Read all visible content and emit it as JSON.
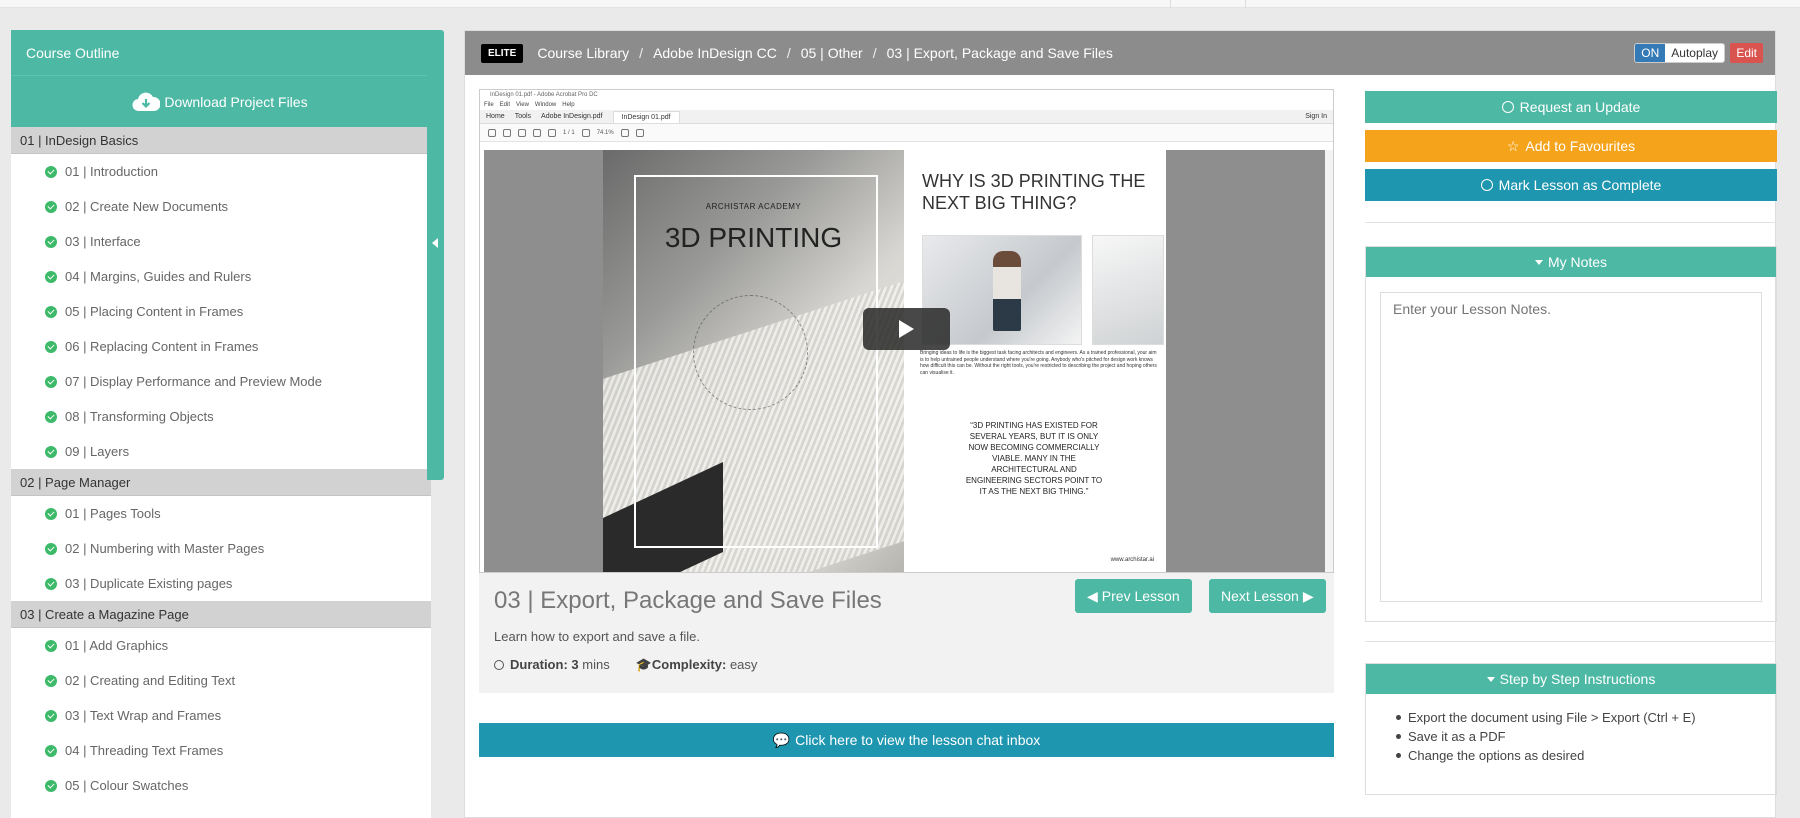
{
  "sidebar": {
    "header": "Course Outline",
    "download_label": "Download Project Files",
    "sections": [
      {
        "title": "01 | InDesign Basics",
        "lessons": [
          "01 | Introduction",
          "02 | Create New Documents",
          "03 | Interface",
          "04 | Margins, Guides and Rulers",
          "05 | Placing Content in Frames",
          "06 | Replacing Content in Frames",
          "07 | Display Performance and Preview Mode",
          "08 | Transforming Objects",
          "09 | Layers"
        ]
      },
      {
        "title": "02 | Page Manager",
        "lessons": [
          "01 | Pages Tools",
          "02 | Numbering with Master Pages",
          "03 | Duplicate Existing pages"
        ]
      },
      {
        "title": "03 | Create a Magazine Page",
        "lessons": [
          "01 | Add Graphics",
          "02 | Creating and Editing Text",
          "03 | Text Wrap and Frames",
          "04 | Threading Text Frames",
          "05 | Colour Swatches"
        ]
      }
    ]
  },
  "breadcrumb": {
    "badge": "ELITE",
    "items": [
      "Course Library",
      "Adobe InDesign CC",
      "05 | Other",
      "03 | Export, Package and Save Files"
    ]
  },
  "autoplay": {
    "state": "ON",
    "label": "Autoplay"
  },
  "edit_label": "Edit",
  "video": {
    "window_title": "InDesign 01.pdf - Adobe Acrobat Pro DC",
    "menu": [
      "File",
      "Edit",
      "View",
      "Window",
      "Help"
    ],
    "tabs": [
      "Home",
      "Tools",
      "Adobe InDesign.pdf",
      "InDesign 01.pdf"
    ],
    "sign_in": "Sign In",
    "page_indicator": "1 / 1",
    "zoom": "74.1%",
    "left_page": {
      "academy": "ARCHISTAR ACADEMY",
      "title": "3D PRINTING",
      "circle_text": "“3D PRINTING HAS EXISTED FOR SEVERAL YEARS, BUT IT IS ONLY NOW BECOMING COMMERCIALLY” ..."
    },
    "right_page": {
      "title": "WHY IS 3D PRINTING THE NEXT BIG THING?",
      "body": "Bringing ideas to life is the biggest task facing architects and engineers. As a trained professional, your aim is to help untrained people understand where you're going. Anybody who's pitched for design work knows how difficult this can be. Without the right tools, you're restricted to describing the project and hoping others can visualise it.",
      "quote": "“3D PRINTING HAS EXISTED FOR SEVERAL YEARS, BUT IT IS ONLY NOW BECOMING COMMERCIALLY VIABLE. MANY IN THE ARCHITECTURAL AND ENGINEERING SECTORS POINT TO IT AS THE NEXT BIG THING.”",
      "url": "www.archistar.ai"
    }
  },
  "lesson": {
    "title": "03 | Export, Package and Save Files",
    "description": "Learn how to export and save a file.",
    "duration_label": "Duration:",
    "duration_value": "3",
    "duration_unit": "mins",
    "complexity_label": "Complexity:",
    "complexity_value": "easy",
    "prev_label": "Prev Lesson",
    "next_label": "Next Lesson"
  },
  "chat_label": "Click here to view the lesson chat inbox",
  "actions": {
    "request_update": "Request an Update",
    "add_favourites": "Add to Favourites",
    "mark_complete": "Mark Lesson as Complete"
  },
  "notes": {
    "title": "My Notes",
    "placeholder": "Enter your Lesson Notes."
  },
  "steps": {
    "title": "Step by Step Instructions",
    "items": [
      "Export the document using File > Export (Ctrl + E)",
      "Save it as a PDF",
      "Change the options as desired"
    ]
  },
  "colors": {
    "teal": "#4db8a4",
    "orange": "#f5a31a",
    "blue": "#1f96af",
    "edit_red": "#d9534f",
    "check_green": "#3cba6a"
  }
}
